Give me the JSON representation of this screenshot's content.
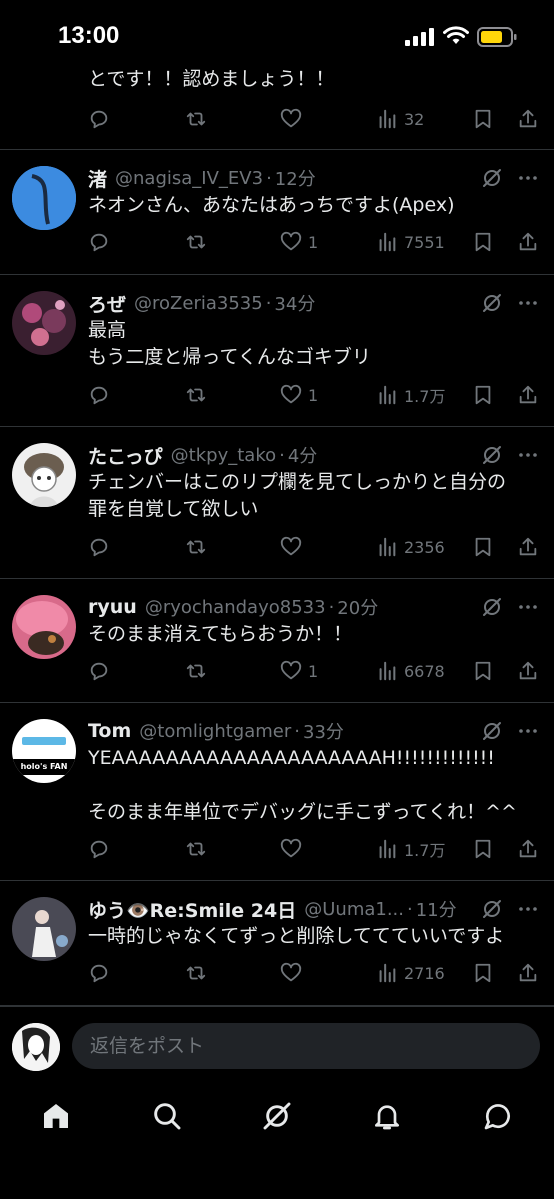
{
  "status_bar": {
    "time": "13:00"
  },
  "top_partial": {
    "text": "とです！！認めましょう！！",
    "views": "32"
  },
  "tweets": [
    {
      "name": "渚",
      "handle": "@nagisa_IV_EV3",
      "time": "12分",
      "text": "ネオンさん、あなたはあっちですよ(Apex)",
      "likes": "1",
      "views": "7551"
    },
    {
      "name": "ろぜ",
      "handle": "@roZeria3535",
      "time": "34分",
      "text": "最高\nもう二度と帰ってくんなゴキブリ",
      "likes": "1",
      "views": "1.7万"
    },
    {
      "name": "たこっぴ",
      "handle": "@tkpy_tako",
      "time": "4分",
      "text": "チェンバーはこのリプ欄を見てしっかりと自分の\n罪を自覚して欲しい",
      "likes": "",
      "views": "2356"
    },
    {
      "name": "ryuu",
      "handle": "@ryochandayo8533",
      "time": "20分",
      "text": "そのまま消えてもらおうか！！",
      "likes": "1",
      "views": "6678"
    },
    {
      "name": "Tom",
      "handle": "@tomlightgamer",
      "time": "33分",
      "text": "YEAAAAAAAAAAAAAAAAAAAAH!!!!!!!!!!!!!\n\nそのまま年単位でデバッグに手こずってくれ！^^",
      "likes": "",
      "views": "1.7万",
      "avatar_text": "holo's FAN"
    },
    {
      "name": "ゆう👁️Re:Smile 24日",
      "handle": "@Uuma1...",
      "time": "11分",
      "text": "一時的じゃなくてずっと削除しててていいですよ",
      "likes": "",
      "views": "2716"
    }
  ],
  "reply": {
    "placeholder": "返信をポスト"
  },
  "nav": [
    "home-icon",
    "search-icon",
    "grok-icon",
    "notifications-icon",
    "messages-icon"
  ]
}
